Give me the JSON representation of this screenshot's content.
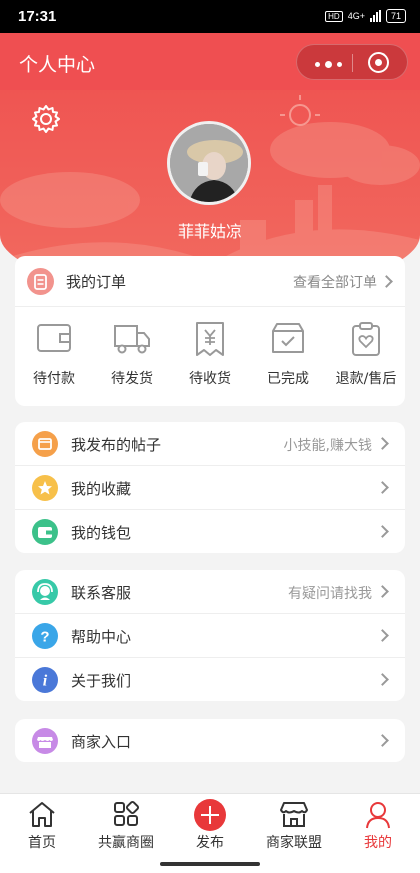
{
  "status_bar": {
    "time": "17:31",
    "network": "4G+",
    "battery": "71"
  },
  "nav": {
    "title": "个人中心"
  },
  "profile": {
    "username": "菲菲姑凉"
  },
  "orders": {
    "title": "我的订单",
    "view_all": "查看全部订单",
    "items": [
      {
        "label": "待付款",
        "icon": "wallet-icon"
      },
      {
        "label": "待发货",
        "icon": "truck-icon"
      },
      {
        "label": "待收货",
        "icon": "receipt-icon"
      },
      {
        "label": "已完成",
        "icon": "box-check-icon"
      },
      {
        "label": "退款/售后",
        "icon": "clipboard-heart-icon"
      }
    ]
  },
  "menu_group_1": [
    {
      "label": "我发布的帖子",
      "hint": "小技能,赚大钱",
      "icon": "post-icon",
      "color": "#f5a04a"
    },
    {
      "label": "我的收藏",
      "hint": "",
      "icon": "star-icon",
      "color": "#f7c04a"
    },
    {
      "label": "我的钱包",
      "hint": "",
      "icon": "wallet-icon",
      "color": "#3cc18a"
    }
  ],
  "menu_group_2": [
    {
      "label": "联系客服",
      "hint": "有疑问请找我",
      "icon": "customer-service-icon",
      "color": "#37c9a8"
    },
    {
      "label": "帮助中心",
      "hint": "",
      "icon": "question-icon",
      "color": "#3aa6e8"
    },
    {
      "label": "关于我们",
      "hint": "",
      "icon": "info-icon",
      "color": "#4a78d8"
    }
  ],
  "menu_group_3": [
    {
      "label": "商家入口",
      "hint": "",
      "icon": "shop-icon",
      "color": "#c78ae6"
    }
  ],
  "tabbar": [
    {
      "label": "首页",
      "icon": "home-icon"
    },
    {
      "label": "共赢商圈",
      "icon": "grid-icon"
    },
    {
      "label": "发布",
      "icon": "plus-icon"
    },
    {
      "label": "商家联盟",
      "icon": "store-icon"
    },
    {
      "label": "我的",
      "icon": "user-icon",
      "active": true
    }
  ],
  "colors": {
    "primary": "#ef4f51",
    "active_tab": "#e8383a",
    "background": "#f3f3f3"
  }
}
